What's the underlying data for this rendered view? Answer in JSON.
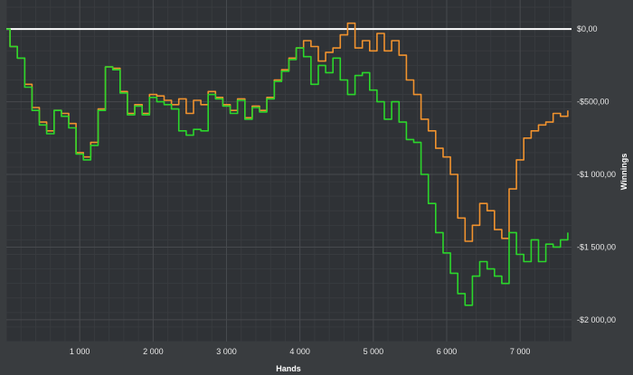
{
  "chart_data": {
    "type": "line",
    "title": "",
    "xlabel": "Hands",
    "ylabel": "Winnings",
    "xlim": [
      0,
      7700
    ],
    "ylim": [
      -2150,
      200
    ],
    "grid": true,
    "x_ticks": [
      {
        "value": 1000,
        "label": "1 000"
      },
      {
        "value": 2000,
        "label": "2 000"
      },
      {
        "value": 3000,
        "label": "3 000"
      },
      {
        "value": 4000,
        "label": "4 000"
      },
      {
        "value": 5000,
        "label": "5 000"
      },
      {
        "value": 6000,
        "label": "6 000"
      },
      {
        "value": 7000,
        "label": "7 000"
      }
    ],
    "y_ticks": [
      {
        "value": 0,
        "label": "$0,00"
      },
      {
        "value": -500,
        "label": "-$500,00"
      },
      {
        "value": -1000,
        "label": "-$1 000,00"
      },
      {
        "value": -1500,
        "label": "-$1 500,00"
      },
      {
        "value": -2000,
        "label": "-$2 000,00"
      }
    ],
    "baseline": {
      "value": 0,
      "color": "#ffffff"
    },
    "series": [
      {
        "color": "#f0922e",
        "x": [
          0,
          50,
          150,
          250,
          350,
          450,
          550,
          650,
          750,
          850,
          950,
          1050,
          1150,
          1250,
          1350,
          1450,
          1550,
          1650,
          1750,
          1850,
          1950,
          2050,
          2150,
          2250,
          2350,
          2450,
          2550,
          2650,
          2750,
          2850,
          2950,
          3050,
          3150,
          3250,
          3350,
          3450,
          3550,
          3650,
          3750,
          3850,
          3950,
          4050,
          4150,
          4250,
          4350,
          4450,
          4550,
          4650,
          4750,
          4850,
          4950,
          5050,
          5150,
          5250,
          5350,
          5450,
          5550,
          5650,
          5750,
          5850,
          5950,
          6050,
          6150,
          6250,
          6350,
          6450,
          6550,
          6650,
          6750,
          6850,
          6950,
          7050,
          7150,
          7250,
          7350,
          7450,
          7550,
          7650
        ],
        "y": [
          0,
          -120,
          -200,
          -380,
          -540,
          -640,
          -700,
          -560,
          -580,
          -650,
          -850,
          -880,
          -780,
          -550,
          -260,
          -270,
          -430,
          -580,
          -520,
          -580,
          -450,
          -460,
          -490,
          -520,
          -480,
          -580,
          -490,
          -520,
          -430,
          -470,
          -520,
          -560,
          -480,
          -610,
          -530,
          -560,
          -470,
          -350,
          -280,
          -200,
          -130,
          -80,
          -120,
          -220,
          -160,
          -130,
          -40,
          40,
          -130,
          -80,
          -150,
          -30,
          -150,
          -80,
          -180,
          -350,
          -450,
          -620,
          -700,
          -820,
          -880,
          -1000,
          -1300,
          -1460,
          -1350,
          -1200,
          -1250,
          -1380,
          -1440,
          -1100,
          -900,
          -750,
          -700,
          -660,
          -640,
          -580,
          -600,
          -560
        ]
      },
      {
        "color": "#2bd62b",
        "x": [
          0,
          50,
          150,
          250,
          350,
          450,
          550,
          650,
          750,
          850,
          950,
          1050,
          1150,
          1250,
          1350,
          1450,
          1550,
          1650,
          1750,
          1850,
          1950,
          2050,
          2150,
          2250,
          2350,
          2450,
          2550,
          2650,
          2750,
          2850,
          2950,
          3050,
          3150,
          3250,
          3350,
          3450,
          3550,
          3650,
          3750,
          3850,
          3950,
          4050,
          4150,
          4250,
          4350,
          4450,
          4550,
          4650,
          4750,
          4850,
          4950,
          5050,
          5150,
          5250,
          5350,
          5450,
          5550,
          5650,
          5750,
          5850,
          5950,
          6050,
          6150,
          6250,
          6350,
          6450,
          6550,
          6650,
          6750,
          6850,
          6950,
          7050,
          7150,
          7250,
          7350,
          7450,
          7550,
          7650
        ],
        "y": [
          0,
          -120,
          -200,
          -400,
          -560,
          -660,
          -720,
          -560,
          -600,
          -680,
          -860,
          -900,
          -800,
          -560,
          -260,
          -280,
          -440,
          -590,
          -530,
          -590,
          -470,
          -500,
          -520,
          -550,
          -700,
          -730,
          -690,
          -700,
          -450,
          -480,
          -530,
          -580,
          -490,
          -620,
          -540,
          -570,
          -480,
          -360,
          -290,
          -210,
          -130,
          -190,
          -380,
          -250,
          -300,
          -200,
          -350,
          -450,
          -320,
          -300,
          -420,
          -500,
          -620,
          -500,
          -640,
          -760,
          -780,
          -1000,
          -1200,
          -1400,
          -1540,
          -1680,
          -1820,
          -1900,
          -1700,
          -1600,
          -1650,
          -1700,
          -1750,
          -1400,
          -1550,
          -1600,
          -1450,
          -1600,
          -1480,
          -1500,
          -1450,
          -1400
        ]
      }
    ]
  }
}
